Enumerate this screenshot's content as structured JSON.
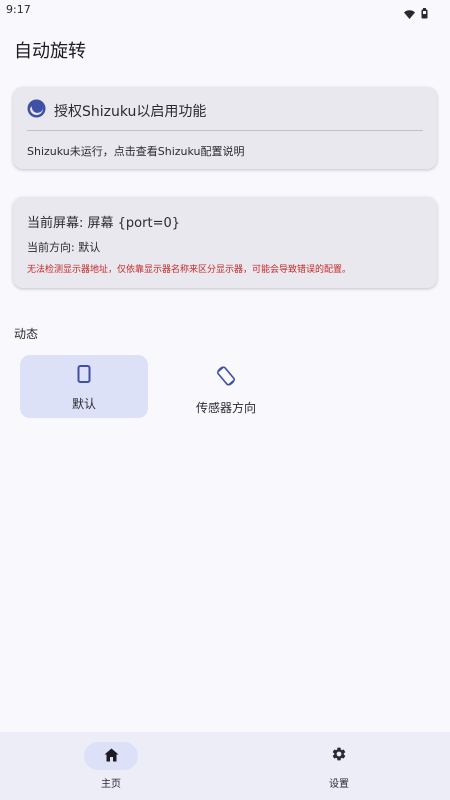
{
  "status_bar": {
    "time": "9:17",
    "icons": [
      "wifi-icon",
      "battery-icon"
    ]
  },
  "header": {
    "title": "自动旋转"
  },
  "shizuku_card": {
    "title": "授权Shizuku以启用功能",
    "description": "Shizuku未运行，点击查看Shizuku配置说明",
    "icon": "shizuku-icon"
  },
  "display_card": {
    "screen_line": "当前屏幕: 屏幕 {port=0}",
    "orientation_line": "当前方向: 默认",
    "warning": "无法检测显示器地址，仅依靠显示器名称来区分显示器，可能会导致错误的配置。",
    "warning_color": "#c62828"
  },
  "dynamic_section": {
    "label": "动态",
    "options": [
      {
        "label": "默认",
        "icon": "phone-portrait-icon",
        "selected": true
      },
      {
        "label": "传感器方向",
        "icon": "screen-rotation-icon",
        "selected": false
      }
    ]
  },
  "bottom_nav": {
    "items": [
      {
        "label": "主页",
        "icon": "home-icon",
        "active": true
      },
      {
        "label": "设置",
        "icon": "gear-icon",
        "active": false
      }
    ]
  },
  "colors": {
    "background": "#f8f8fd",
    "card": "#e8e8ee",
    "accent_container": "#dde1f8",
    "accent": "#3f51a5",
    "nav_background": "#ecedf6"
  }
}
